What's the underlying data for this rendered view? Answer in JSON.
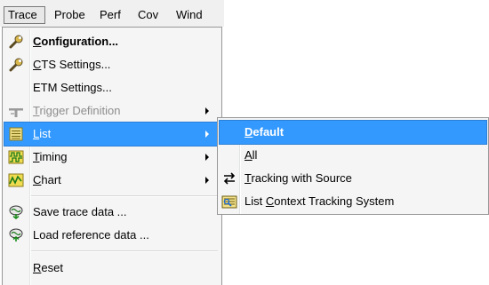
{
  "menubar": {
    "items": [
      {
        "label": "Trace"
      },
      {
        "label": "Probe"
      },
      {
        "label": "Perf"
      },
      {
        "label": "Cov"
      },
      {
        "label": "Wind"
      }
    ]
  },
  "trace_menu": {
    "items": [
      {
        "accel": "C",
        "rest": "onfiguration...",
        "icon": "wrench-icon"
      },
      {
        "accel": "C",
        "rest": "TS Settings...",
        "icon": "wrench-icon"
      },
      {
        "accel": "",
        "rest": "ETM Settings...",
        "icon": ""
      },
      {
        "accel": "T",
        "rest": "rigger Definition",
        "icon": "trigger-icon"
      },
      {
        "accel": "L",
        "rest": "ist",
        "icon": "list-icon"
      },
      {
        "accel": "T",
        "rest": "iming",
        "icon": "timing-icon"
      },
      {
        "accel": "C",
        "rest": "hart",
        "icon": "chart-icon"
      },
      {
        "label": "Save trace data ...",
        "icon": "save-trace-icon"
      },
      {
        "label": "Load reference data ...",
        "icon": "load-reference-icon"
      },
      {
        "accel": "R",
        "rest": "eset",
        "icon": ""
      }
    ]
  },
  "list_submenu": {
    "items": [
      {
        "accel": "D",
        "rest": "efault"
      },
      {
        "accel": "A",
        "rest": "ll"
      },
      {
        "accel": "T",
        "rest": "racking with Source",
        "icon": "tracking-arrows-icon"
      },
      {
        "pre": "List ",
        "accel": "C",
        "rest": "ontext Tracking System",
        "icon": "context-tracking-icon"
      }
    ]
  },
  "colors": {
    "highlight": "#3399ff",
    "menu_bg": "#f5f5f5",
    "disabled_text": "#8d8d8d"
  }
}
